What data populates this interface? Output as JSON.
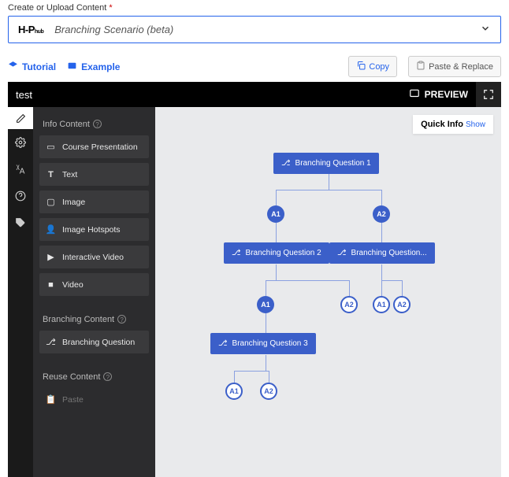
{
  "header": {
    "label": "Create or Upload Content"
  },
  "selector": {
    "logo_main": "H-P",
    "logo_sub": "hub",
    "content_type": "Branching Scenario (beta)"
  },
  "toolbar": {
    "tutorial": "Tutorial",
    "example": "Example",
    "copy": "Copy",
    "paste_replace": "Paste & Replace"
  },
  "editor": {
    "title": "test",
    "preview": "PREVIEW"
  },
  "sidebar": {
    "section_info": "Info Content",
    "items_info": [
      {
        "label": "Course Presentation"
      },
      {
        "label": "Text"
      },
      {
        "label": "Image"
      },
      {
        "label": "Image Hotspots"
      },
      {
        "label": "Interactive Video"
      },
      {
        "label": "Video"
      }
    ],
    "section_branch": "Branching Content",
    "items_branch": [
      {
        "label": "Branching Question"
      }
    ],
    "section_reuse": "Reuse Content",
    "items_reuse": [
      {
        "label": "Paste"
      }
    ]
  },
  "canvas": {
    "quick_info": "Quick Info",
    "show": "Show",
    "nodes": {
      "q1": "Branching Question 1",
      "q2": "Branching Question 2",
      "q3": "Branching Question...",
      "q4": "Branching Question 3",
      "a1": "A1",
      "a2": "A2"
    }
  }
}
